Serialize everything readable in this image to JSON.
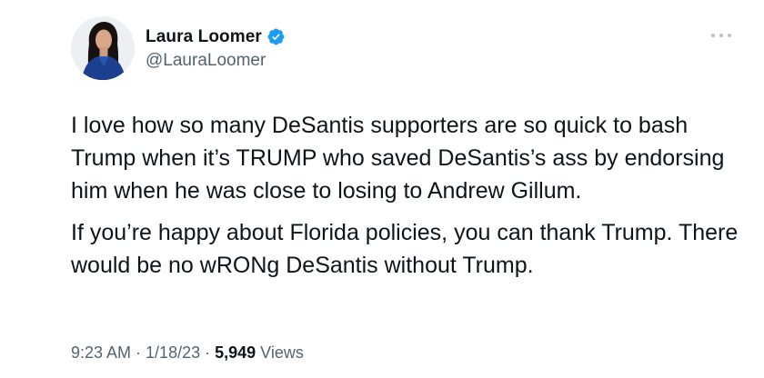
{
  "author": {
    "display_name": "Laura Loomer",
    "handle": "@LauraLoomer",
    "verified": true
  },
  "icons": {
    "verified": "verified-badge-icon",
    "more": "more-horizontal-icon"
  },
  "tweet": {
    "paragraphs": [
      "I love how so many DeSantis supporters are so quick to bash Trump when it’s TRUMP who saved DeSantis’s ass by endorsing him when he was close to losing to Andrew Gillum.",
      "If you’re happy about Florida policies, you can thank Trump. There would be no wRONg DeSantis without Trump."
    ]
  },
  "meta": {
    "time": "9:23 AM",
    "sep1": " · ",
    "date": "1/18/23",
    "sep2": " · ",
    "views_count": "5,949",
    "views_label": " Views"
  },
  "colors": {
    "verified_blue": "#1d9bf0",
    "text_primary": "#0f1419",
    "text_secondary": "#536471"
  }
}
